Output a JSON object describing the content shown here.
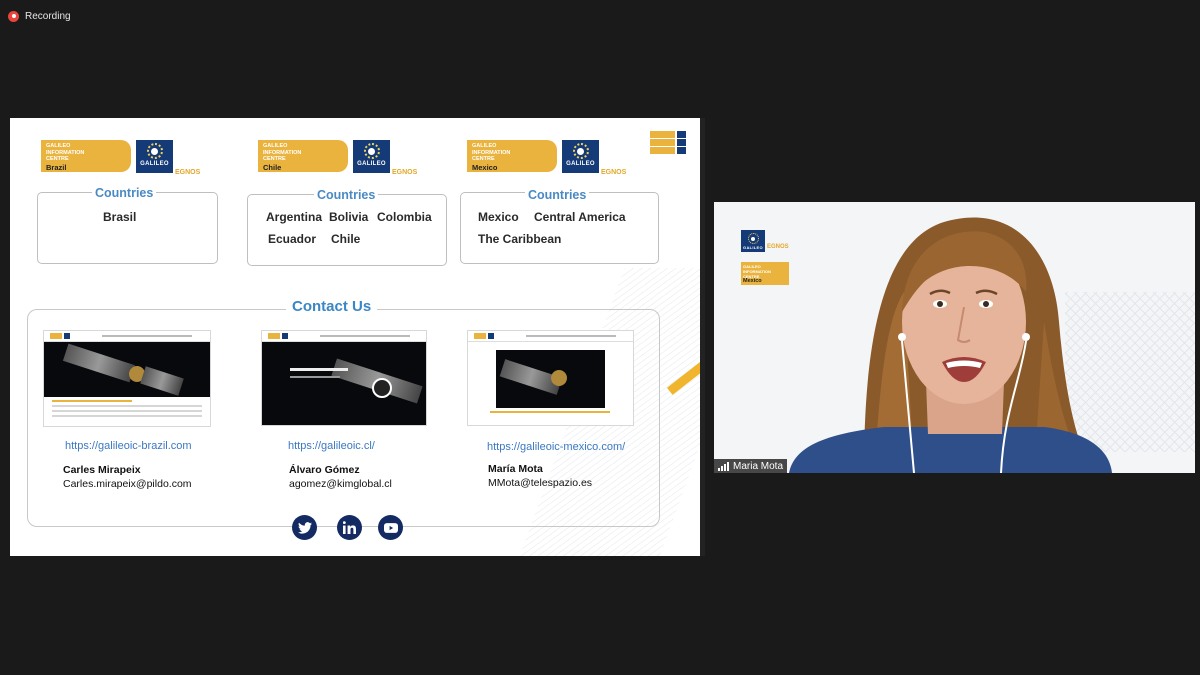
{
  "recording": {
    "label": "Recording"
  },
  "slide": {
    "centres": [
      {
        "logo": {
          "line1": "GALILEO",
          "line2": "INFORMATION",
          "line3": "CENTRE",
          "country": "Brazil",
          "galileo": "GALILEO",
          "egnos": "EGNOS"
        },
        "countries_title": "Countries",
        "countries": [
          "Brasil"
        ]
      },
      {
        "logo": {
          "line1": "GALILEO",
          "line2": "INFORMATION",
          "line3": "CENTRE",
          "country": "Chile",
          "galileo": "GALILEO",
          "egnos": "EGNOS"
        },
        "countries_title": "Countries",
        "countries": [
          "Argentina",
          "Bolivia",
          "Colombia",
          "Ecuador",
          "Chile"
        ]
      },
      {
        "logo": {
          "line1": "GALILEO",
          "line2": "INFORMATION",
          "line3": "CENTRE",
          "country": "Mexico",
          "galileo": "GALILEO",
          "egnos": "EGNOS"
        },
        "countries_title": "Countries",
        "countries": [
          "Mexico",
          "Central America",
          "The Caribbean"
        ]
      }
    ],
    "contact": {
      "title": "Contact Us",
      "entries": [
        {
          "url": "https://galileoic-brazil.com",
          "name": "Carles Mirapeix",
          "email": "Carles.mirapeix@pildo.com"
        },
        {
          "url": "https://galileoic.cl/",
          "name": "Álvaro Gómez",
          "email": "agomez@kimglobal.cl"
        },
        {
          "url": "https://galileoic-mexico.com/",
          "name": "María Mota",
          "email": "MMota@telespazio.es"
        }
      ]
    },
    "social": [
      "twitter-icon",
      "linkedin-icon",
      "youtube-icon"
    ]
  },
  "video": {
    "participant_name": "Maria Mota",
    "logo": {
      "galileo": "GALILEO",
      "egnos": "EGNOS",
      "tag_line1": "GALILEO",
      "tag_line2": "INFORMATION",
      "tag_line3": "CENTRE",
      "tag_country": "Mexico"
    }
  },
  "colors": {
    "accent_blue": "#3b86c4",
    "gold": "#e9b33d",
    "navy": "#153a78",
    "background": "#1a1a1a"
  }
}
